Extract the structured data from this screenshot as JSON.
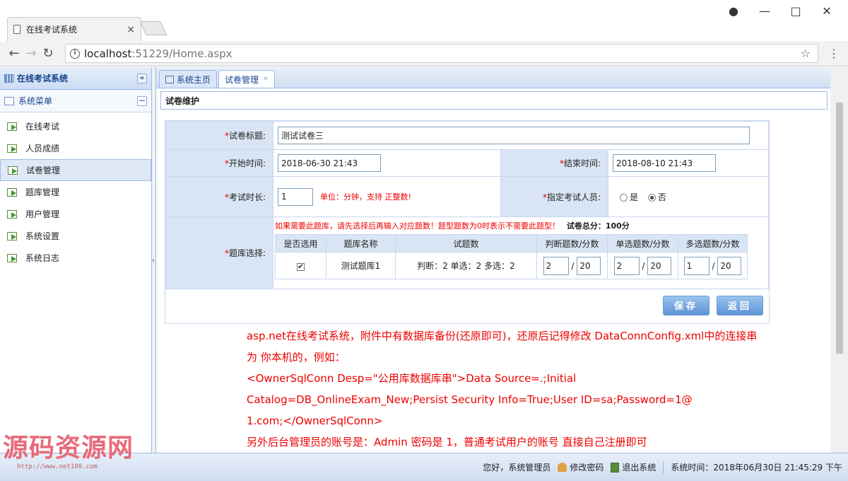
{
  "browser": {
    "tab_title": "在线考试系统",
    "tab_close": "×",
    "url_host": "localhost",
    "url_rest": ":51229/Home.aspx",
    "info_glyph": "i"
  },
  "sidebar": {
    "title": "在线考试系统",
    "collapse": "«",
    "menu_title": "系统菜单",
    "menu_toggle": "−",
    "items": [
      {
        "label": "在线考试"
      },
      {
        "label": "人员成绩"
      },
      {
        "label": "试卷管理"
      },
      {
        "label": "题库管理"
      },
      {
        "label": "用户管理"
      },
      {
        "label": "系统设置"
      },
      {
        "label": "系统日志"
      }
    ]
  },
  "tabs": [
    {
      "label": "系统主页"
    },
    {
      "label": "试卷管理"
    }
  ],
  "panel_title": "试卷维护",
  "form": {
    "title_label": "试卷标题:",
    "title_value": "测试试卷三",
    "start_label": "开始时间:",
    "start_value": "2018-06-30 21:43",
    "end_label": "结束时间:",
    "end_value": "2018-08-10 21:43",
    "duration_label": "考试时长:",
    "duration_value": "1",
    "duration_hint": "单位：分钟，支持 正整数!",
    "assign_label": "指定考试人员:",
    "assign_yes": "是",
    "assign_no": "否",
    "bank_label": "题库选择:",
    "bank_note": "如果需要此题库，请先选择后再输入对应题数！题型题数为0时表示不需要此题型！",
    "total_score": "试卷总分：100分",
    "bank_headers": [
      "是否选用",
      "题库名称",
      "试题数",
      "判断题数/分数",
      "单选题数/分数",
      "多选题数/分数"
    ],
    "bank_row": {
      "checked": "✔",
      "name": "测试题库1",
      "counts": "判断：2 单选：2 多选：2",
      "judge_num": "2",
      "judge_score": "20",
      "single_num": "2",
      "single_score": "20",
      "multi_num": "1",
      "multi_score": "20"
    },
    "save_label": "保存",
    "back_label": "返回"
  },
  "description": [
    "asp.net在线考试系统，附件中有数据库备份(还原即可)，还原后记得修改 DataConnConfig.xml中的连接串",
    "为 你本机的，例如：",
    "<OwnerSqlConn Desp=\"公用库数据库串\">Data Source=.;Initial",
    "Catalog=DB_OnlineExam_New;Persist Security Info=True;User ID=sa;Password=1@",
    "1.com;</OwnerSqlConn>",
    "另外后台管理员的账号是：Admin 密码是 1，普通考试用户的账号 直接自己注册即可"
  ],
  "status": {
    "greeting": "您好，系统管理员",
    "change_pwd": "修改密码",
    "logout": "退出系统",
    "time": "系统时间：2018年06月30日 21:45:29 下午"
  },
  "watermark": {
    "text": "源码资源网",
    "url": "http://www.net188.com"
  },
  "colors": {
    "accent": "#99bbe8",
    "required": "#dd0000"
  }
}
